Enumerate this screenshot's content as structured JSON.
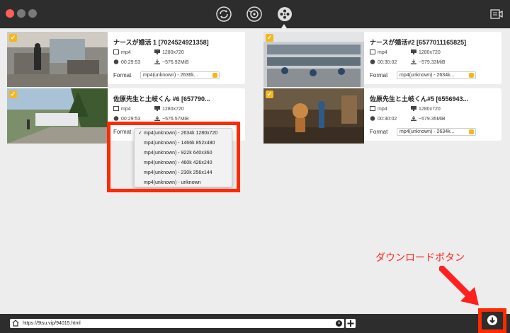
{
  "urlbar": {
    "url": "https://9tsu.vip/94015.html"
  },
  "videos": [
    {
      "title": "ナースが婚活 1 [7024524921358]",
      "container": "mp4",
      "resolution": "1280x720",
      "duration": "00:29:53",
      "size": "~576.92MiB",
      "format_label": "Format",
      "format_value": "mp4(unknown) - 2636k..."
    },
    {
      "title": "ナースが婚活#2 [6577011165825]",
      "container": "mp4",
      "resolution": "1280x720",
      "duration": "00:30:02",
      "size": "~579.33MiB",
      "format_label": "Format",
      "format_value": "mp4(unknown) - 2634k..."
    },
    {
      "title": "佐原先生と土岐くん #6 [657790...",
      "container": "mp4",
      "resolution": "1280x720",
      "duration": "00:29:53",
      "size": "~576.57MiB",
      "format_label": "Format",
      "format_value": ""
    },
    {
      "title": "佐原先生と土岐くん#5 [6556943...",
      "container": "mp4",
      "resolution": "1280x720",
      "duration": "00:30:02",
      "size": "~579.35MiB",
      "format_label": "Format",
      "format_value": "mp4(unknown) - 2634k..."
    }
  ],
  "format_dropdown": {
    "options": [
      "mp4(unknown) - 2634k 1280x720",
      "mp4(unknown) - 1466k 852x480",
      "mp4(unknown) - 922k 640x360",
      "mp4(unknown) - 460k 426x240",
      "mp4(unknown) - 230k 256x144",
      "mp4(unknown) - unknown"
    ],
    "check_mark": "✓"
  },
  "annotation": {
    "text": "ダウンロードボタン"
  },
  "icons": {
    "toolbar": [
      "refresh-icon",
      "convert-icon",
      "film-reel-icon",
      "screen-record-icon"
    ],
    "bottom": [
      "home-icon",
      "clear-icon",
      "add-icon",
      "download-icon"
    ]
  },
  "colors": {
    "accent": "#f6b71c",
    "highlight": "#ff2a00",
    "bar": "#2d2d2d"
  }
}
